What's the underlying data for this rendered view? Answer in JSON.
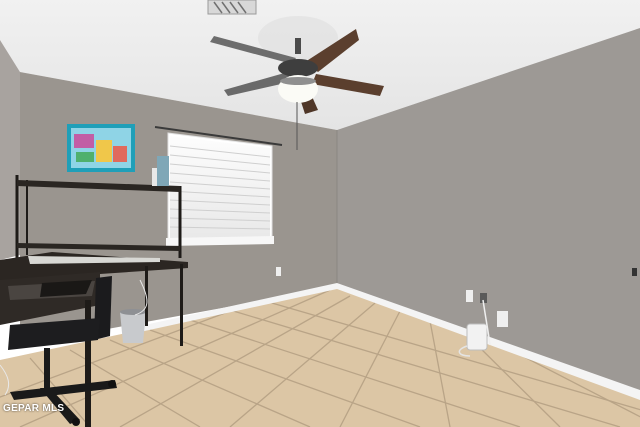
{
  "watermark": {
    "text": "GEPAR MLS"
  },
  "colors": {
    "ceiling": "#ececec",
    "wall_left": "#a19c97",
    "wall_back": "#97928d",
    "wall_right": "#9b9793",
    "baseboard": "#f3f3f3",
    "floor_tile": "#ddc7a6",
    "grout": "#b7a284",
    "desk": "#2b2622",
    "fan_blade": "#5b3f2e",
    "window_blinds": "#f4f4f4"
  }
}
